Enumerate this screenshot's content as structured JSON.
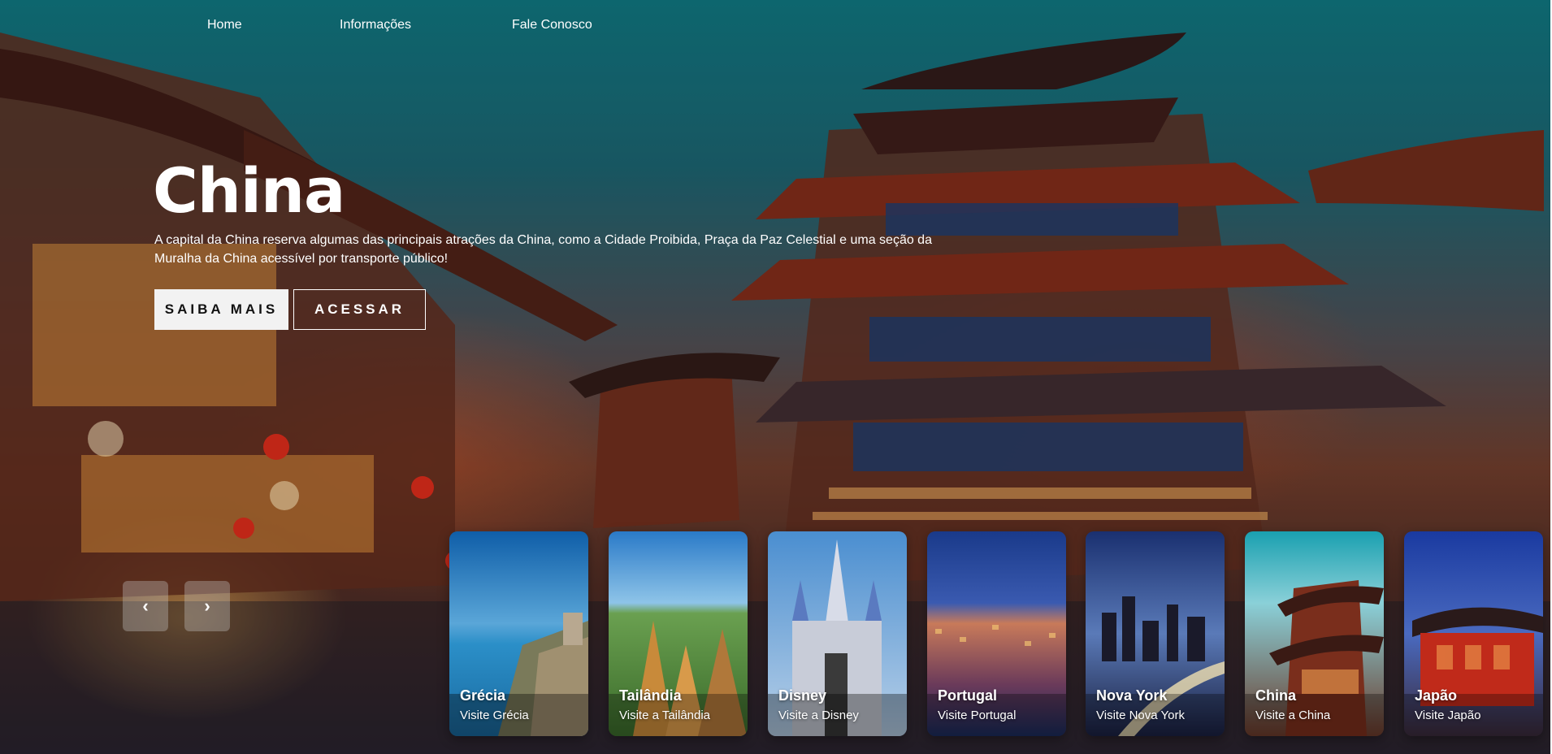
{
  "nav": {
    "items": [
      {
        "label": "Home"
      },
      {
        "label": "Informações"
      },
      {
        "label": "Fale Conosco"
      }
    ]
  },
  "hero": {
    "title": "China",
    "description": "A capital da China reserva algumas das principais atrações da China, como a Cidade Proibida, Praça da Paz Celestial e uma seção da Muralha da China acessível por transporte público!",
    "primary_button": "SAIBA MAIS",
    "secondary_button": "ACESSAR"
  },
  "carousel": {
    "prev_icon": "‹",
    "next_icon": "›",
    "cards": [
      {
        "title": "Grécia",
        "subtitle": "Visite Grécia"
      },
      {
        "title": "Tailândia",
        "subtitle": "Visite a Tailândia"
      },
      {
        "title": "Disney",
        "subtitle": "Visite a Disney"
      },
      {
        "title": "Portugal",
        "subtitle": "Visite Portugal"
      },
      {
        "title": "Nova York",
        "subtitle": "Visite Nova York"
      },
      {
        "title": "China",
        "subtitle": "Visite a China"
      },
      {
        "title": "Japão",
        "subtitle": "Visite Japão"
      }
    ]
  },
  "colors": {
    "sky": "#0f6f78",
    "button_primary_bg": "#f2f2f2",
    "text": "#ffffff"
  }
}
